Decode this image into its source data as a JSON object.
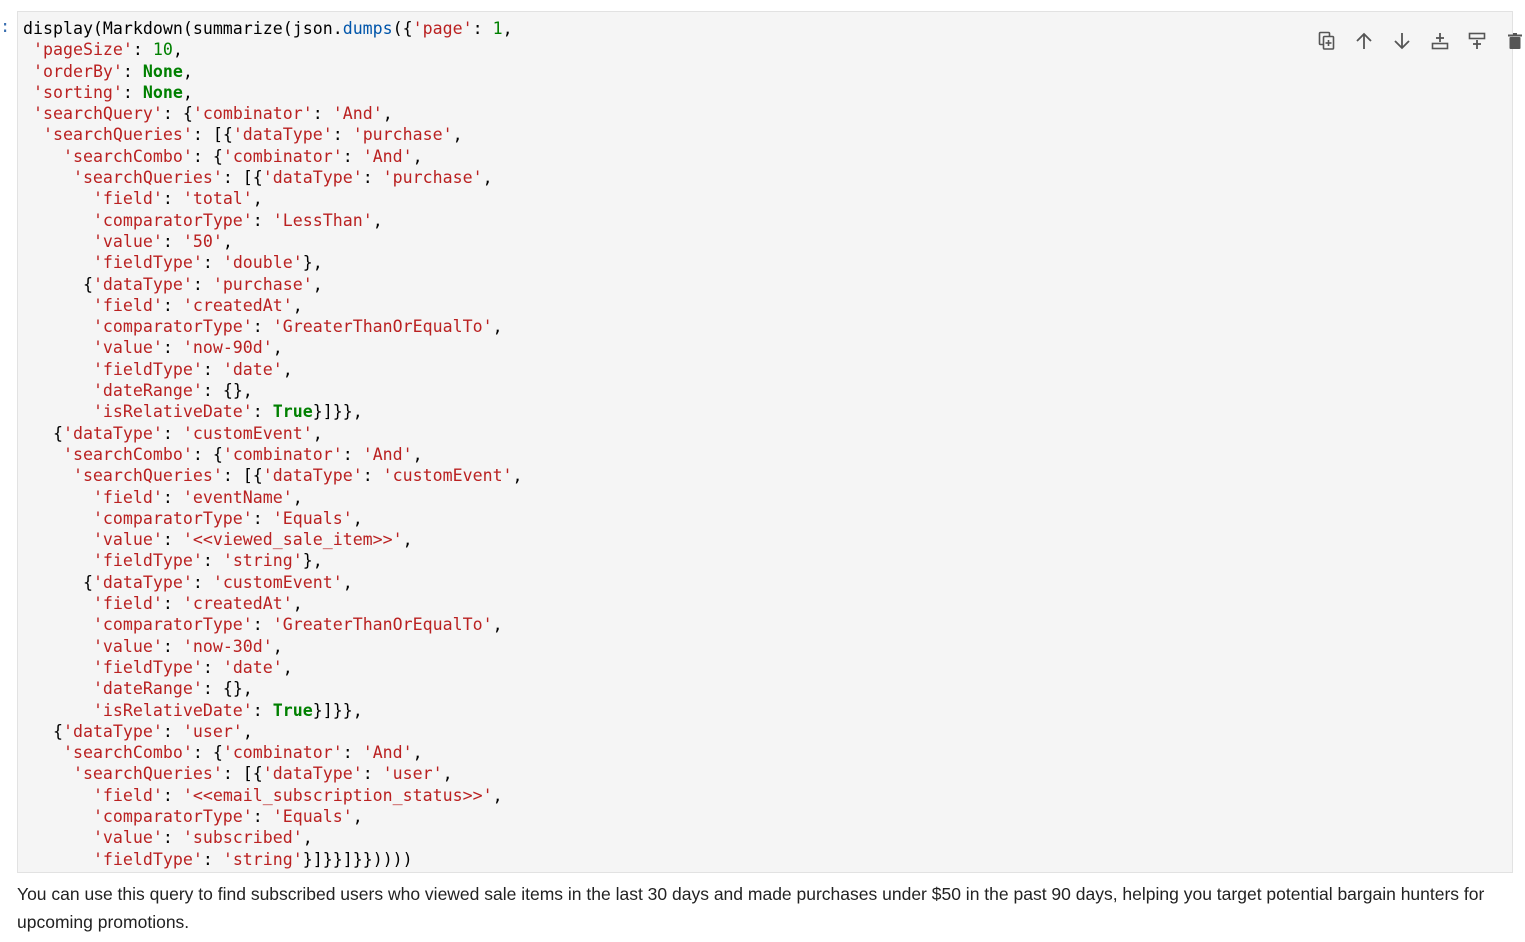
{
  "cell": {
    "prompt": ":",
    "toolbar": [
      {
        "name": "duplicate-cell",
        "icon": "copy-icon"
      },
      {
        "name": "move-up",
        "icon": "arrow-up-icon"
      },
      {
        "name": "move-down",
        "icon": "arrow-down-icon"
      },
      {
        "name": "insert-above",
        "icon": "insert-above-icon"
      },
      {
        "name": "insert-below",
        "icon": "insert-below-icon"
      },
      {
        "name": "delete-cell",
        "icon": "trash-icon"
      }
    ],
    "code_lines": [
      [
        [
          "p",
          "display(Markdown(summarize(json."
        ],
        [
          "m",
          "dumps"
        ],
        [
          "p",
          "({"
        ],
        [
          "s",
          "'page'"
        ],
        [
          "p",
          ": "
        ],
        [
          "n",
          "1"
        ],
        [
          "p",
          ","
        ]
      ],
      [
        [
          "p",
          " "
        ],
        [
          "s",
          "'pageSize'"
        ],
        [
          "p",
          ": "
        ],
        [
          "n",
          "10"
        ],
        [
          "p",
          ","
        ]
      ],
      [
        [
          "p",
          " "
        ],
        [
          "s",
          "'orderBy'"
        ],
        [
          "p",
          ": "
        ],
        [
          "k",
          "None"
        ],
        [
          "p",
          ","
        ]
      ],
      [
        [
          "p",
          " "
        ],
        [
          "s",
          "'sorting'"
        ],
        [
          "p",
          ": "
        ],
        [
          "k",
          "None"
        ],
        [
          "p",
          ","
        ]
      ],
      [
        [
          "p",
          " "
        ],
        [
          "s",
          "'searchQuery'"
        ],
        [
          "p",
          ": {"
        ],
        [
          "s",
          "'combinator'"
        ],
        [
          "p",
          ": "
        ],
        [
          "s",
          "'And'"
        ],
        [
          "p",
          ","
        ]
      ],
      [
        [
          "p",
          "  "
        ],
        [
          "s",
          "'searchQueries'"
        ],
        [
          "p",
          ": [{"
        ],
        [
          "s",
          "'dataType'"
        ],
        [
          "p",
          ": "
        ],
        [
          "s",
          "'purchase'"
        ],
        [
          "p",
          ","
        ]
      ],
      [
        [
          "p",
          "    "
        ],
        [
          "s",
          "'searchCombo'"
        ],
        [
          "p",
          ": {"
        ],
        [
          "s",
          "'combinator'"
        ],
        [
          "p",
          ": "
        ],
        [
          "s",
          "'And'"
        ],
        [
          "p",
          ","
        ]
      ],
      [
        [
          "p",
          "     "
        ],
        [
          "s",
          "'searchQueries'"
        ],
        [
          "p",
          ": [{"
        ],
        [
          "s",
          "'dataType'"
        ],
        [
          "p",
          ": "
        ],
        [
          "s",
          "'purchase'"
        ],
        [
          "p",
          ","
        ]
      ],
      [
        [
          "p",
          "       "
        ],
        [
          "s",
          "'field'"
        ],
        [
          "p",
          ": "
        ],
        [
          "s",
          "'total'"
        ],
        [
          "p",
          ","
        ]
      ],
      [
        [
          "p",
          "       "
        ],
        [
          "s",
          "'comparatorType'"
        ],
        [
          "p",
          ": "
        ],
        [
          "s",
          "'LessThan'"
        ],
        [
          "p",
          ","
        ]
      ],
      [
        [
          "p",
          "       "
        ],
        [
          "s",
          "'value'"
        ],
        [
          "p",
          ": "
        ],
        [
          "s",
          "'50'"
        ],
        [
          "p",
          ","
        ]
      ],
      [
        [
          "p",
          "       "
        ],
        [
          "s",
          "'fieldType'"
        ],
        [
          "p",
          ": "
        ],
        [
          "s",
          "'double'"
        ],
        [
          "p",
          "},"
        ]
      ],
      [
        [
          "p",
          "      {"
        ],
        [
          "s",
          "'dataType'"
        ],
        [
          "p",
          ": "
        ],
        [
          "s",
          "'purchase'"
        ],
        [
          "p",
          ","
        ]
      ],
      [
        [
          "p",
          "       "
        ],
        [
          "s",
          "'field'"
        ],
        [
          "p",
          ": "
        ],
        [
          "s",
          "'createdAt'"
        ],
        [
          "p",
          ","
        ]
      ],
      [
        [
          "p",
          "       "
        ],
        [
          "s",
          "'comparatorType'"
        ],
        [
          "p",
          ": "
        ],
        [
          "s",
          "'GreaterThanOrEqualTo'"
        ],
        [
          "p",
          ","
        ]
      ],
      [
        [
          "p",
          "       "
        ],
        [
          "s",
          "'value'"
        ],
        [
          "p",
          ": "
        ],
        [
          "s",
          "'now-90d'"
        ],
        [
          "p",
          ","
        ]
      ],
      [
        [
          "p",
          "       "
        ],
        [
          "s",
          "'fieldType'"
        ],
        [
          "p",
          ": "
        ],
        [
          "s",
          "'date'"
        ],
        [
          "p",
          ","
        ]
      ],
      [
        [
          "p",
          "       "
        ],
        [
          "s",
          "'dateRange'"
        ],
        [
          "p",
          ": {},"
        ]
      ],
      [
        [
          "p",
          "       "
        ],
        [
          "s",
          "'isRelativeDate'"
        ],
        [
          "p",
          ": "
        ],
        [
          "k",
          "True"
        ],
        [
          "p",
          "}]}},"
        ]
      ],
      [
        [
          "p",
          "   {"
        ],
        [
          "s",
          "'dataType'"
        ],
        [
          "p",
          ": "
        ],
        [
          "s",
          "'customEvent'"
        ],
        [
          "p",
          ","
        ]
      ],
      [
        [
          "p",
          "    "
        ],
        [
          "s",
          "'searchCombo'"
        ],
        [
          "p",
          ": {"
        ],
        [
          "s",
          "'combinator'"
        ],
        [
          "p",
          ": "
        ],
        [
          "s",
          "'And'"
        ],
        [
          "p",
          ","
        ]
      ],
      [
        [
          "p",
          "     "
        ],
        [
          "s",
          "'searchQueries'"
        ],
        [
          "p",
          ": [{"
        ],
        [
          "s",
          "'dataType'"
        ],
        [
          "p",
          ": "
        ],
        [
          "s",
          "'customEvent'"
        ],
        [
          "p",
          ","
        ]
      ],
      [
        [
          "p",
          "       "
        ],
        [
          "s",
          "'field'"
        ],
        [
          "p",
          ": "
        ],
        [
          "s",
          "'eventName'"
        ],
        [
          "p",
          ","
        ]
      ],
      [
        [
          "p",
          "       "
        ],
        [
          "s",
          "'comparatorType'"
        ],
        [
          "p",
          ": "
        ],
        [
          "s",
          "'Equals'"
        ],
        [
          "p",
          ","
        ]
      ],
      [
        [
          "p",
          "       "
        ],
        [
          "s",
          "'value'"
        ],
        [
          "p",
          ": "
        ],
        [
          "s",
          "'<<viewed_sale_item>>'"
        ],
        [
          "p",
          ","
        ]
      ],
      [
        [
          "p",
          "       "
        ],
        [
          "s",
          "'fieldType'"
        ],
        [
          "p",
          ": "
        ],
        [
          "s",
          "'string'"
        ],
        [
          "p",
          "},"
        ]
      ],
      [
        [
          "p",
          "      {"
        ],
        [
          "s",
          "'dataType'"
        ],
        [
          "p",
          ": "
        ],
        [
          "s",
          "'customEvent'"
        ],
        [
          "p",
          ","
        ]
      ],
      [
        [
          "p",
          "       "
        ],
        [
          "s",
          "'field'"
        ],
        [
          "p",
          ": "
        ],
        [
          "s",
          "'createdAt'"
        ],
        [
          "p",
          ","
        ]
      ],
      [
        [
          "p",
          "       "
        ],
        [
          "s",
          "'comparatorType'"
        ],
        [
          "p",
          ": "
        ],
        [
          "s",
          "'GreaterThanOrEqualTo'"
        ],
        [
          "p",
          ","
        ]
      ],
      [
        [
          "p",
          "       "
        ],
        [
          "s",
          "'value'"
        ],
        [
          "p",
          ": "
        ],
        [
          "s",
          "'now-30d'"
        ],
        [
          "p",
          ","
        ]
      ],
      [
        [
          "p",
          "       "
        ],
        [
          "s",
          "'fieldType'"
        ],
        [
          "p",
          ": "
        ],
        [
          "s",
          "'date'"
        ],
        [
          "p",
          ","
        ]
      ],
      [
        [
          "p",
          "       "
        ],
        [
          "s",
          "'dateRange'"
        ],
        [
          "p",
          ": {},"
        ]
      ],
      [
        [
          "p",
          "       "
        ],
        [
          "s",
          "'isRelativeDate'"
        ],
        [
          "p",
          ": "
        ],
        [
          "k",
          "True"
        ],
        [
          "p",
          "}]}},"
        ]
      ],
      [
        [
          "p",
          "   {"
        ],
        [
          "s",
          "'dataType'"
        ],
        [
          "p",
          ": "
        ],
        [
          "s",
          "'user'"
        ],
        [
          "p",
          ","
        ]
      ],
      [
        [
          "p",
          "    "
        ],
        [
          "s",
          "'searchCombo'"
        ],
        [
          "p",
          ": {"
        ],
        [
          "s",
          "'combinator'"
        ],
        [
          "p",
          ": "
        ],
        [
          "s",
          "'And'"
        ],
        [
          "p",
          ","
        ]
      ],
      [
        [
          "p",
          "     "
        ],
        [
          "s",
          "'searchQueries'"
        ],
        [
          "p",
          ": [{"
        ],
        [
          "s",
          "'dataType'"
        ],
        [
          "p",
          ": "
        ],
        [
          "s",
          "'user'"
        ],
        [
          "p",
          ","
        ]
      ],
      [
        [
          "p",
          "       "
        ],
        [
          "s",
          "'field'"
        ],
        [
          "p",
          ": "
        ],
        [
          "s",
          "'<<email_subscription_status>>'"
        ],
        [
          "p",
          ","
        ]
      ],
      [
        [
          "p",
          "       "
        ],
        [
          "s",
          "'comparatorType'"
        ],
        [
          "p",
          ": "
        ],
        [
          "s",
          "'Equals'"
        ],
        [
          "p",
          ","
        ]
      ],
      [
        [
          "p",
          "       "
        ],
        [
          "s",
          "'value'"
        ],
        [
          "p",
          ": "
        ],
        [
          "s",
          "'subscribed'"
        ],
        [
          "p",
          ","
        ]
      ],
      [
        [
          "p",
          "       "
        ],
        [
          "s",
          "'fieldType'"
        ],
        [
          "p",
          ": "
        ],
        [
          "s",
          "'string'"
        ],
        [
          "p",
          "}]}}]}}))))"
        ]
      ]
    ]
  },
  "output": {
    "text": "You can use this query to find subscribed users who viewed sale items in the last 30 days and made purchases under $50 in the past 90 days, helping you target potential bargain hunters for upcoming promotions."
  }
}
